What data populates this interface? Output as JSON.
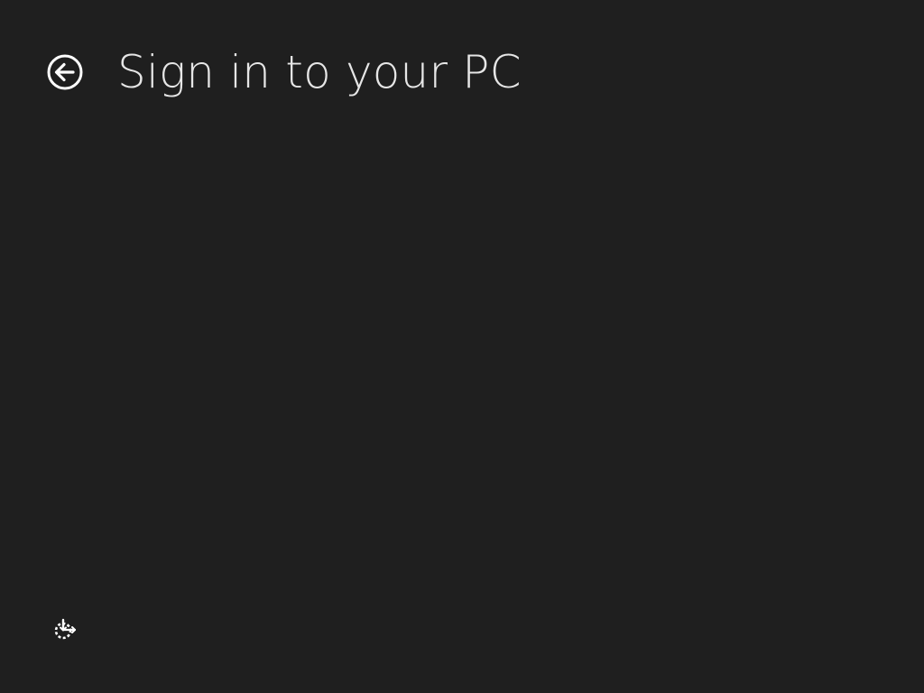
{
  "header": {
    "title": "Sign in to your PC",
    "back_icon": "arrow-left-circle-icon"
  },
  "footer": {
    "ease_of_access_icon": "ease-of-access-icon"
  },
  "colors": {
    "background": "#1f1f1f",
    "foreground": "#e6e6e6"
  }
}
